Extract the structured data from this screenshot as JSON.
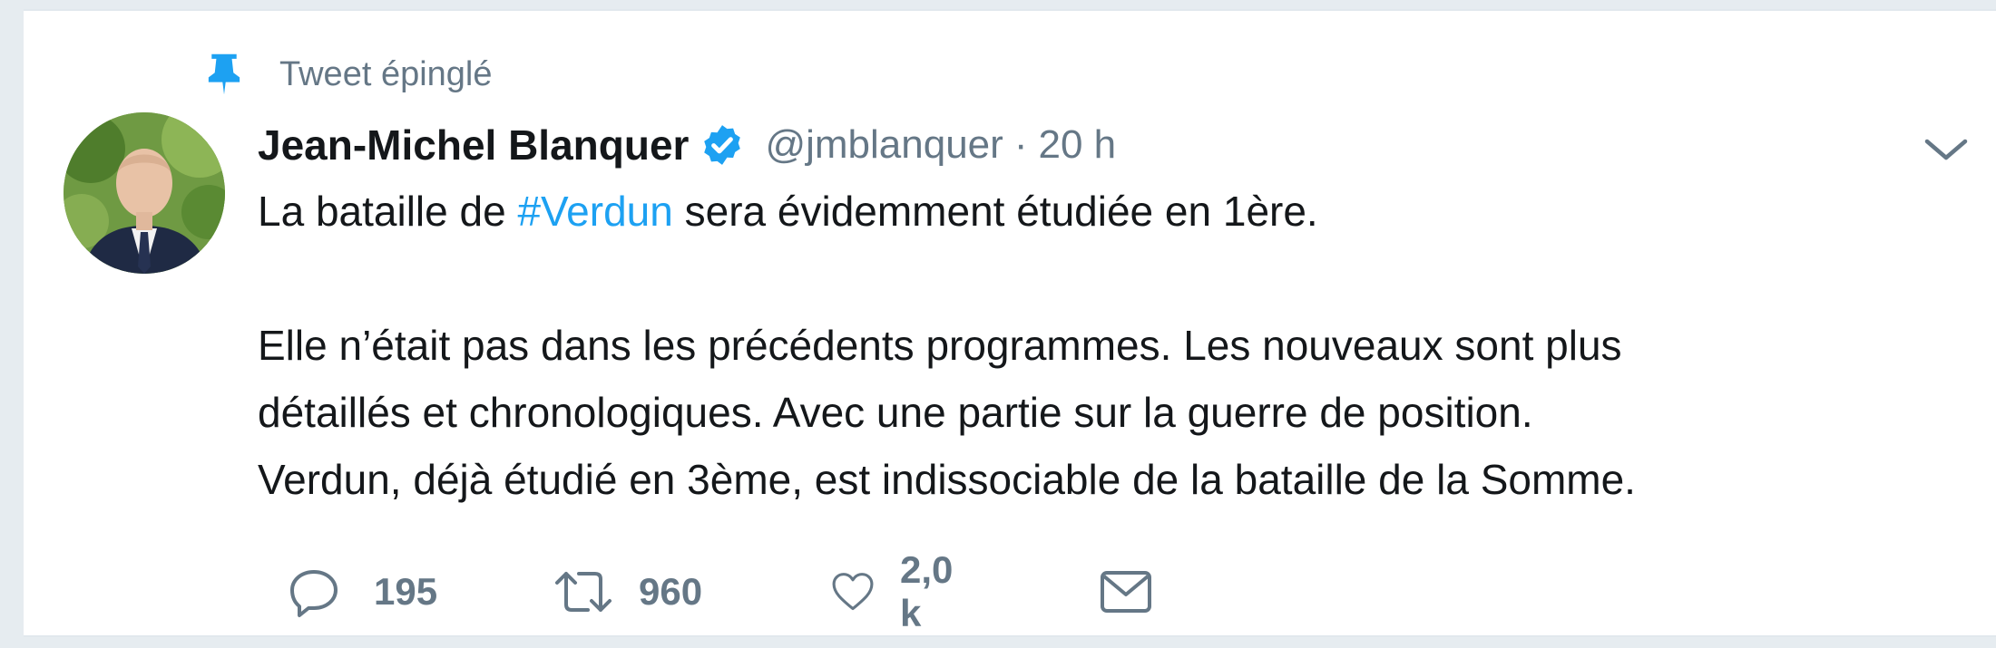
{
  "pinned_label": "Tweet épinglé",
  "author": {
    "name": "Jean-Michel Blanquer",
    "handle": "@jmblanquer",
    "separator": "·",
    "time": "20 h"
  },
  "tweet": {
    "line1_before": "La bataille de ",
    "line1_hashtag": "#Verdun",
    "line1_after": " sera évidemment étudiée en 1ère.",
    "line2": "Elle n’était pas dans les précédents programmes. Les nouveaux sont plus",
    "line3": "détaillés et chronologiques. Avec une partie sur la guerre de position.",
    "line4": "Verdun, déjà étudié en 3ème, est indissociable de la bataille de la Somme."
  },
  "actions": {
    "reply_count": "195",
    "retweet_count": "960",
    "like_count": "2,0 k"
  },
  "colors": {
    "accent": "#1da1f2",
    "text": "#14171a",
    "muted": "#657786",
    "background": "#e6ecf0"
  },
  "icons": [
    "pin-icon",
    "verified-icon",
    "caret-down-icon",
    "reply-icon",
    "retweet-icon",
    "like-icon",
    "message-icon"
  ]
}
